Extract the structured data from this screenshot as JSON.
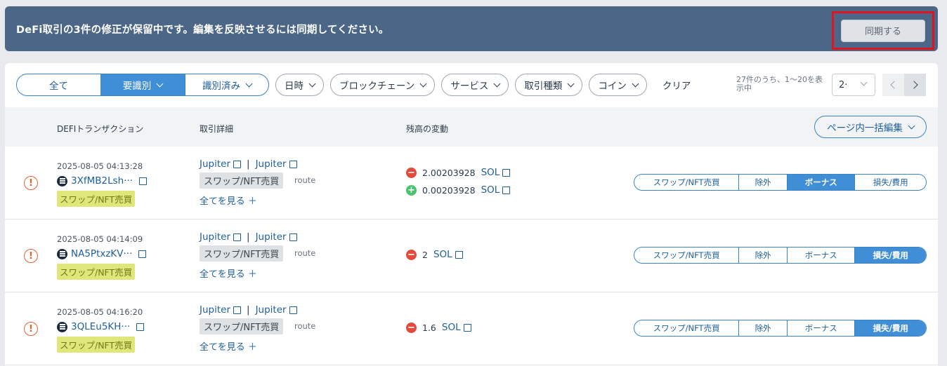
{
  "banner": {
    "message": "DeFi取引の3件の修正が保留中です。編集を反映させるには同期してください。",
    "sync_label": "同期する"
  },
  "filters": {
    "segments": [
      "全て",
      "要識別",
      "識別済み"
    ],
    "active_segment": "要識別",
    "pills": [
      "日時",
      "ブロックチェーン",
      "サービス",
      "取引種類",
      "コイン"
    ],
    "clear_label": "クリア",
    "count_text": "27件のうち、1〜20を表示中",
    "per_page": "2·"
  },
  "table": {
    "headers": [
      "DEFIトランザクション",
      "取引詳細",
      "残高の変動"
    ],
    "bulk_edit_label": "ページ内一括編集",
    "category_options": [
      "スワップ/NFT売買",
      "除外",
      "ボーナス",
      "損失/費用"
    ],
    "rows": [
      {
        "date": "2025-08-05 04:13:28",
        "tx": "3XfMB2Lsh···",
        "tx_tag": "スワップ/NFT売買",
        "service_1": "Jupiter",
        "service_2": "Jupiter",
        "detail_tag": "スワップ/NFT売買",
        "route": "route",
        "see_all": "全てを見る",
        "changes": [
          {
            "sign": "-",
            "amount": "2.00203928",
            "unit": "SOL"
          },
          {
            "sign": "+",
            "amount": "0.00203928",
            "unit": "SOL"
          }
        ],
        "selected_category": "ボーナス"
      },
      {
        "date": "2025-08-05 04:14:09",
        "tx": "NA5PtxzKV···",
        "tx_tag": "スワップ/NFT売買",
        "service_1": "Jupiter",
        "service_2": "Jupiter",
        "detail_tag": "スワップ/NFT売買",
        "route": "route",
        "see_all": "全てを見る",
        "changes": [
          {
            "sign": "-",
            "amount": "2",
            "unit": "SOL"
          }
        ],
        "selected_category": "損失/費用"
      },
      {
        "date": "2025-08-05 04:16:20",
        "tx": "3QLEu5KH···",
        "tx_tag": "スワップ/NFT売買",
        "service_1": "Jupiter",
        "service_2": "Jupiter",
        "detail_tag": "スワップ/NFT売買",
        "route": "route",
        "see_all": "全てを見る",
        "changes": [
          {
            "sign": "-",
            "amount": "1.6",
            "unit": "SOL"
          }
        ],
        "selected_category": "損失/費用"
      }
    ]
  },
  "colors": {
    "banner": "#4b6687",
    "accent": "#3f8ed6",
    "link": "#1f5f99",
    "warning": "#e2622f",
    "minus": "#e04b3c",
    "plus": "#45c46c",
    "tag_yellow": "#dfe77a"
  },
  "icons": {
    "warning": "exclamation-circle-icon",
    "chain": "solana-icon",
    "external": "external-link-icon",
    "minus": "minus-circle-icon",
    "plus": "plus-circle-icon"
  }
}
